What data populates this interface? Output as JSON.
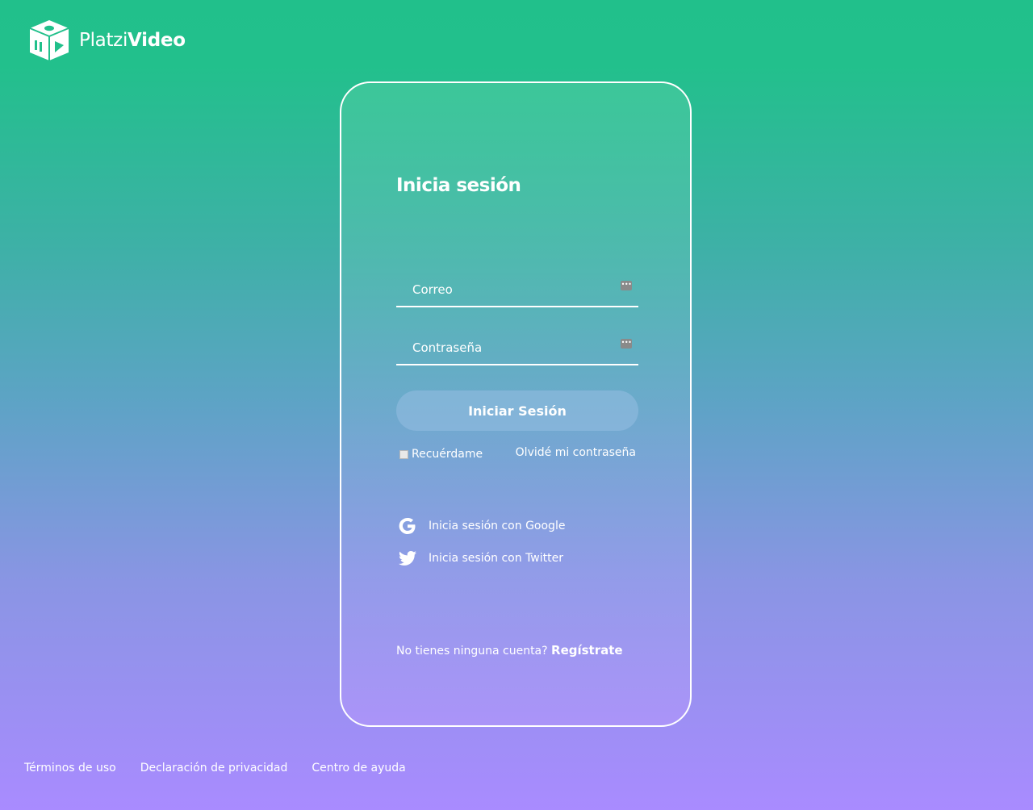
{
  "brand": {
    "name_light": "Platzi",
    "name_bold": "Video",
    "logo_icon": "platzi-video-cube-icon"
  },
  "login": {
    "title": "Inicia sesión",
    "email_placeholder": "Correo",
    "password_placeholder": "Contraseña",
    "submit_label": "Iniciar Sesión",
    "remember_label": "Recuérdame",
    "remember_checked": false,
    "forgot_label": "Olvidé mi contraseña",
    "google_label": "Inicia sesión con Google",
    "twitter_label": "Inicia sesión con Twitter",
    "signup_prompt": "No tienes ninguna cuenta?",
    "signup_link": "Regístrate",
    "field_icon": "password-manager-key-icon"
  },
  "footer": {
    "links": [
      "Términos de uso",
      "Declaración de privacidad",
      "Centro de ayuda"
    ]
  },
  "colors": {
    "gradient_top": "#21c08b",
    "gradient_bottom": "#a98bff",
    "text": "#ffffff"
  }
}
